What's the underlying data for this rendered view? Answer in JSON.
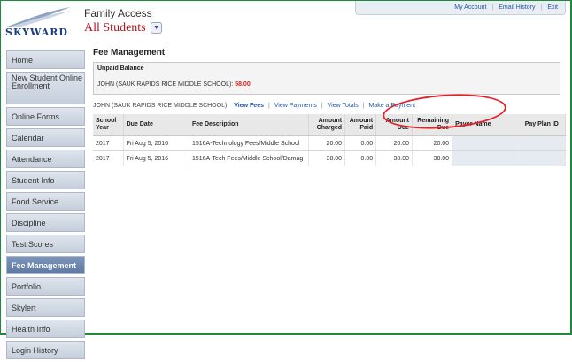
{
  "header": {
    "logo_text": "SKYWARD",
    "app_title": "Family Access",
    "student_selector": "All Students",
    "top_nav": [
      "My Account",
      "Email History",
      "Exit"
    ]
  },
  "sidebar": {
    "items": [
      {
        "label": "Home"
      },
      {
        "label": "New Student Online Enrollment"
      },
      {
        "label": "Online Forms"
      },
      {
        "label": "Calendar"
      },
      {
        "label": "Attendance"
      },
      {
        "label": "Student Info"
      },
      {
        "label": "Food Service"
      },
      {
        "label": "Discipline"
      },
      {
        "label": "Test Scores"
      },
      {
        "label": "Fee Management",
        "active": true
      },
      {
        "label": "Portfolio"
      },
      {
        "label": "Skylert"
      },
      {
        "label": "Health Info"
      },
      {
        "label": "Login History"
      }
    ]
  },
  "main": {
    "title": "Fee Management",
    "unpaid": {
      "title": "Unpaid Balance",
      "student": "JOHN (SAUK RAPIDS RICE MIDDLE SCHOOL):",
      "amount": "58.00"
    },
    "tabs": {
      "student": "JOHN (SAUK RAPIDS RICE MIDDLE SCHOOL)",
      "links": [
        "View Fees",
        "View Payments",
        "View Totals",
        "Make a Payment"
      ]
    },
    "table": {
      "columns": [
        "School Year",
        "Due Date",
        "Fee Description",
        "Amount Charged",
        "Amount Paid",
        "Amount Due",
        "Remaining Due",
        "Payor Name",
        "Pay Plan ID"
      ],
      "rows": [
        [
          "2017",
          "Fri Aug 5, 2016",
          "1516A-Technology Fees/Middle School",
          "20.00",
          "0.00",
          "20.00",
          "20.00",
          "",
          ""
        ],
        [
          "2017",
          "Fri Aug 5, 2016",
          "1516A-Tech Fees/Middle School/Damag",
          "38.00",
          "0.00",
          "38.00",
          "38.00",
          "",
          ""
        ]
      ]
    }
  },
  "colors": {
    "accent": "#2455a4",
    "alert": "#e21b1b",
    "annotation_circle": "#e2232a",
    "sidebar_active": "#6983ab",
    "frame": "#1f8a3b"
  }
}
